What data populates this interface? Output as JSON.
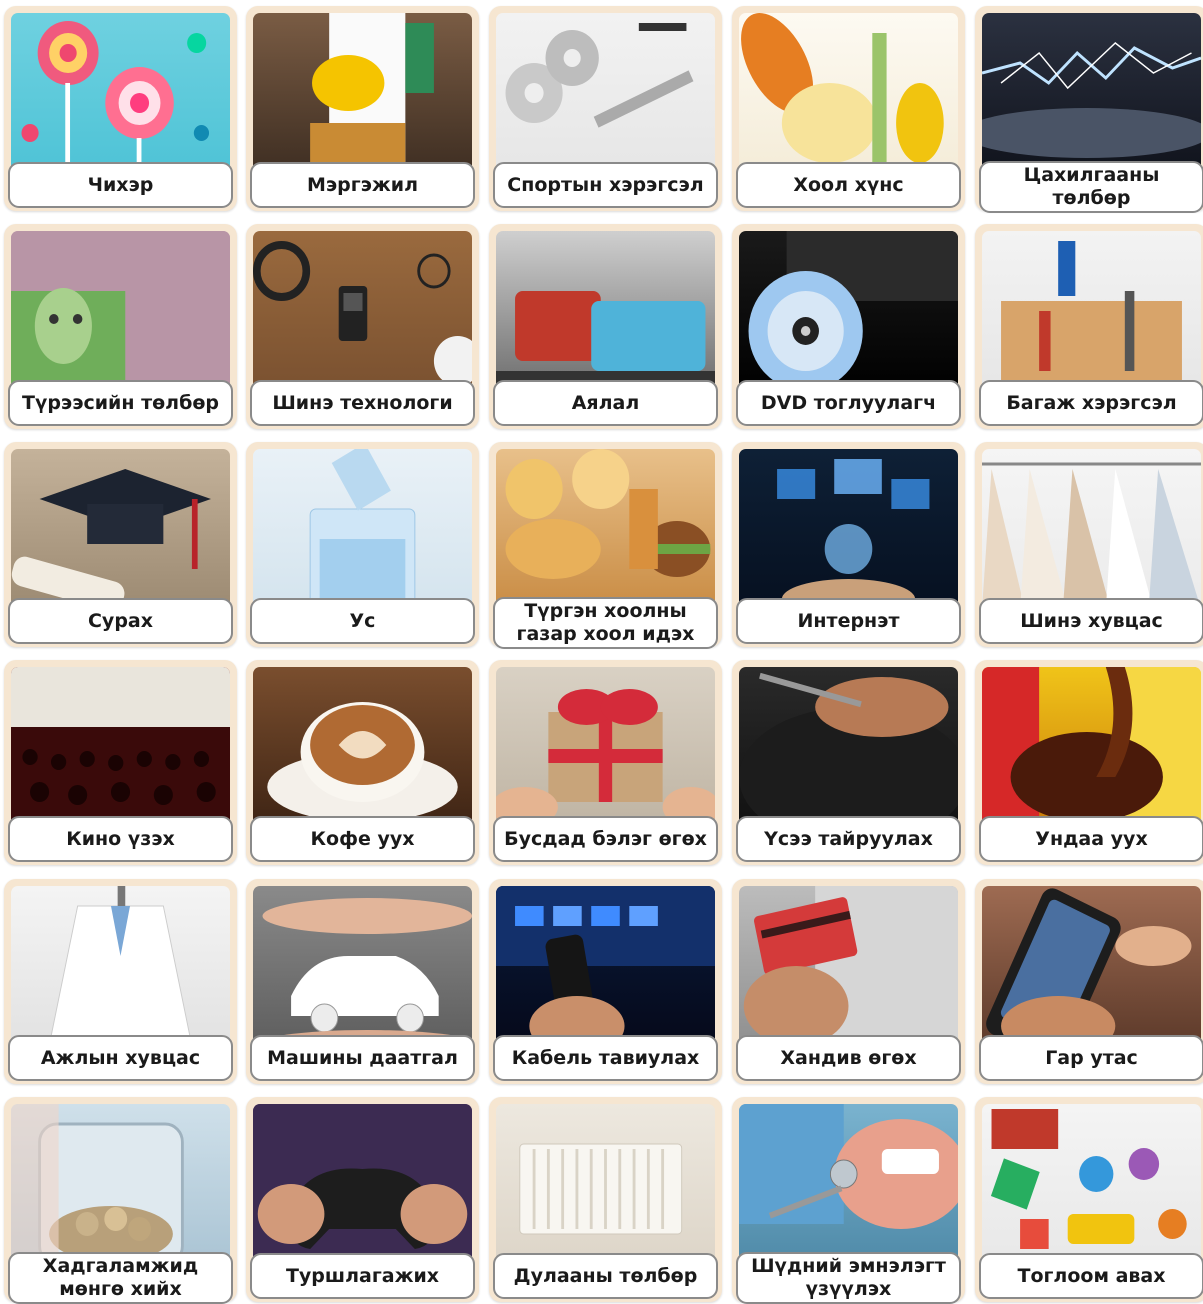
{
  "cards": [
    {
      "label": "Чихэр",
      "image": "lollipop-candies-photo"
    },
    {
      "label": "Мэргэжил",
      "image": "construction-worker-profession-photo"
    },
    {
      "label": "Спортын хэрэгсэл",
      "image": "dumbbell-weights-photo"
    },
    {
      "label": "Хоол хүнс",
      "image": "vegetables-photo"
    },
    {
      "label": "Цахилгааны\nтөлбөр",
      "image": "electric-spark-photo"
    },
    {
      "label": "Түрээсийн төлбөр",
      "image": "tugrik-banknote-photo"
    },
    {
      "label": "Шинэ технологи",
      "image": "headphones-music-player-photo"
    },
    {
      "label": "Аялал",
      "image": "suitcases-luggage-photo"
    },
    {
      "label": "DVD  тоглуулагч",
      "image": "dvd-player-disc-photo"
    },
    {
      "label": "Багаж хэрэгсэл",
      "image": "toolbox-tools-photo"
    },
    {
      "label": "Сурах",
      "image": "graduation-cap-photo"
    },
    {
      "label": "Ус",
      "image": "water-glass-pour-photo"
    },
    {
      "label": "Түргэн хоолны\nгазар хоол идэх",
      "image": "fast-food-photo"
    },
    {
      "label": "Интернэт",
      "image": "internet-hand-icons-photo"
    },
    {
      "label": "Шинэ хувцас",
      "image": "clothes-rack-photo"
    },
    {
      "label": "Кино үзэх",
      "image": "cinema-audience-photo"
    },
    {
      "label": "Кофе уух",
      "image": "latte-art-coffee-photo"
    },
    {
      "label": "Бусдад бэлэг өгөх",
      "image": "gift-box-ribbon-photo"
    },
    {
      "label": "Үсээ тайруулах",
      "image": "haircut-photo"
    },
    {
      "label": "Ундаа уух",
      "image": "soda-pouring-photo"
    },
    {
      "label": "Ажлын хувцас",
      "image": "white-lab-coat-photo"
    },
    {
      "label": "Машины даатгал",
      "image": "car-insurance-hands-photo"
    },
    {
      "label": "Кабель тавиулах",
      "image": "tv-remote-photo"
    },
    {
      "label": "Хандив өгөх",
      "image": "credit-card-laptop-photo"
    },
    {
      "label": "Гар утас",
      "image": "smartphone-hand-photo"
    },
    {
      "label": "Хадгаламжид\nмөнгө хийх",
      "image": "coin-jar-savings-photo"
    },
    {
      "label": "Туршлагажих",
      "image": "game-controller-photo"
    },
    {
      "label": "Дулааны төлбөр",
      "image": "radiator-heater-photo"
    },
    {
      "label": "Шүдний эмнэлэгт\nүзүүлэх",
      "image": "dentist-mirror-photo"
    },
    {
      "label": "Тоглоом авах",
      "image": "fidget-toys-photo"
    }
  ],
  "colors": {
    "card_bg": "#f6e6d1",
    "label_border": "#8a8a8a",
    "label_bg": "#ffffff",
    "text": "#1a1a1a"
  }
}
